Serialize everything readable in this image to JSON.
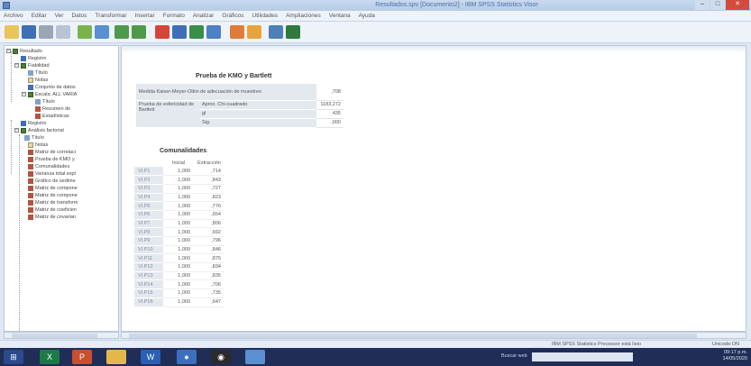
{
  "window": {
    "title": "Resultados.spv [Documento2] - IBM SPSS Statistics Visor",
    "buttons": {
      "minimize": "–",
      "maximize": "□",
      "close": "✕"
    }
  },
  "menu": [
    "Archivo",
    "Editar",
    "Ver",
    "Datos",
    "Transformar",
    "Insertar",
    "Formato",
    "Analizar",
    "Gráficos",
    "Utilidades",
    "Ampliaciones",
    "Ventana",
    "Ayuda"
  ],
  "toolbar": {
    "icons": [
      "open-icon",
      "save-icon",
      "print-icon",
      "print-preview-icon",
      "export-icon",
      "recall-dialog-icon",
      "undo-icon",
      "redo-icon",
      "goto-data-icon",
      "goto-case-icon",
      "variables-icon",
      "chart-icon",
      "insert-output-icon",
      "designate-window-icon",
      "show-all-icon",
      "hide-icon"
    ]
  },
  "navigator": {
    "items": [
      {
        "label": "Resultado",
        "icon": "folder",
        "level": 0
      },
      {
        "label": "Registro",
        "icon": "book",
        "level": 1
      },
      {
        "label": "Fiabilidad",
        "icon": "folder",
        "level": 1
      },
      {
        "label": "Título",
        "icon": "title",
        "level": 2
      },
      {
        "label": "Notas",
        "icon": "note",
        "level": 2
      },
      {
        "label": "Conjunto de datos",
        "icon": "book",
        "level": 2
      },
      {
        "label": "Escala: ALL VARIA",
        "icon": "folder",
        "level": 2
      },
      {
        "label": "Título",
        "icon": "title",
        "level": 3
      },
      {
        "label": "Resumen de",
        "icon": "table",
        "level": 3
      },
      {
        "label": "Estadísticas",
        "icon": "table",
        "level": 3
      },
      {
        "label": "Registro",
        "icon": "book",
        "level": 1
      },
      {
        "label": "Análisis factorial",
        "icon": "folder",
        "level": 1
      },
      {
        "label": "Título",
        "icon": "title",
        "level": 2
      },
      {
        "label": "Notas",
        "icon": "note",
        "level": 2
      },
      {
        "label": "Matriz de correlaci",
        "icon": "table",
        "level": 2
      },
      {
        "label": "Prueba de KMO y",
        "icon": "table",
        "level": 2
      },
      {
        "label": "Comunalidades",
        "icon": "table",
        "level": 2
      },
      {
        "label": "Varianza total expl",
        "icon": "table",
        "level": 2
      },
      {
        "label": "Gráfico de sedime",
        "icon": "table",
        "level": 2
      },
      {
        "label": "Matriz de compone",
        "icon": "table",
        "level": 2
      },
      {
        "label": "Matriz de compone",
        "icon": "table",
        "level": 2
      },
      {
        "label": "Matriz de transform",
        "icon": "table",
        "level": 2
      },
      {
        "label": "Matriz de coeficien",
        "icon": "table",
        "level": 2
      },
      {
        "label": "Matriz de covarian",
        "icon": "table",
        "level": 2
      }
    ]
  },
  "kmo": {
    "title": "Prueba de KMO y Bartlett",
    "rows": [
      {
        "label": "Medida Kaiser-Meyer-Olkin de adecuación de muestreo",
        "sub": "",
        "value": ",708"
      },
      {
        "label": "Prueba de esfericidad de Bartlett",
        "sub": "Aprox. Chi-cuadrado",
        "value": "1183,272"
      },
      {
        "label": "",
        "sub": "gl",
        "value": "435"
      },
      {
        "label": "",
        "sub": "Sig.",
        "value": ",000"
      }
    ]
  },
  "communalities": {
    "title": "Comunalidades",
    "headers": [
      "",
      "Inicial",
      "Extracción"
    ],
    "rows": [
      [
        "VI.P1",
        "1,000",
        ",714"
      ],
      [
        "VI.P2",
        "1,000",
        ",843"
      ],
      [
        "VI.P3",
        "1,000",
        ",727"
      ],
      [
        "VI.P4",
        "1,000",
        ",823"
      ],
      [
        "VI.P5",
        "1,000",
        ",776"
      ],
      [
        "VI.P6",
        "1,000",
        ",654"
      ],
      [
        "VI.P7",
        "1,000",
        ",806"
      ],
      [
        "VI.P8",
        "1,000",
        ",692"
      ],
      [
        "VI.P9",
        "1,000",
        ",796"
      ],
      [
        "VI.P10",
        "1,000",
        ",846"
      ],
      [
        "VI.P11",
        "1,000",
        ",875"
      ],
      [
        "VI.P12",
        "1,000",
        ",834"
      ],
      [
        "VI.P13",
        "1,000",
        ",835"
      ],
      [
        "VI.P14",
        "1,000",
        ",706"
      ],
      [
        "VI.P15",
        "1,000",
        ",735"
      ],
      [
        "VI.P16",
        "1,000",
        ",647"
      ]
    ]
  },
  "status": {
    "processor": "IBM SPSS Statistics Processor está listo",
    "encoding": "Unicode:ON"
  },
  "taskbar": {
    "search_placeholder": "Buscar web",
    "time": "09:17 p.m.",
    "date": "14/05/2020"
  }
}
